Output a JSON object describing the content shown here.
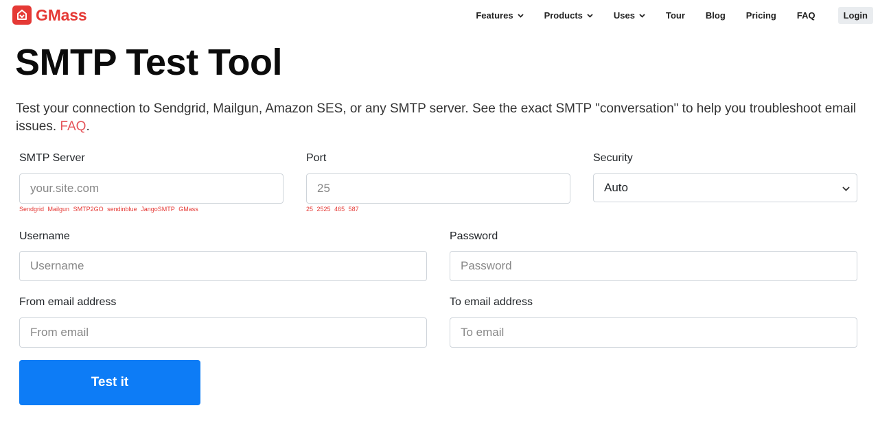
{
  "brand": {
    "name": "GMass",
    "color": "#e53935"
  },
  "nav": {
    "items": [
      {
        "label": "Features",
        "dropdown": true
      },
      {
        "label": "Products",
        "dropdown": true
      },
      {
        "label": "Uses",
        "dropdown": true
      },
      {
        "label": "Tour",
        "dropdown": false
      },
      {
        "label": "Blog",
        "dropdown": false
      },
      {
        "label": "Pricing",
        "dropdown": false
      },
      {
        "label": "FAQ",
        "dropdown": false
      }
    ],
    "login_label": "Login"
  },
  "page": {
    "title": "SMTP Test Tool",
    "intro_text": "Test your connection to Sendgrid, Mailgun, Amazon SES, or any SMTP server. See the exact SMTP \"conversation\" to help you troubleshoot email issues.",
    "intro_link": "FAQ",
    "intro_end": "."
  },
  "form": {
    "smtp_server": {
      "label": "SMTP Server",
      "placeholder": "your.site.com",
      "suggestions": [
        "Sendgrid",
        "Mailgun",
        "SMTP2GO",
        "sendinblue",
        "JangoSMTP",
        "GMass"
      ]
    },
    "port": {
      "label": "Port",
      "placeholder": "25",
      "suggestions": [
        "25",
        "2525",
        "465",
        "587"
      ]
    },
    "security": {
      "label": "Security",
      "selected": "Auto"
    },
    "username": {
      "label": "Username",
      "placeholder": "Username"
    },
    "password": {
      "label": "Password",
      "placeholder": "Password"
    },
    "from_email": {
      "label": "From email address",
      "placeholder": "From email"
    },
    "to_email": {
      "label": "To email address",
      "placeholder": "To email"
    },
    "submit_label": "Test it",
    "submit_color": "#0d7cf6"
  }
}
